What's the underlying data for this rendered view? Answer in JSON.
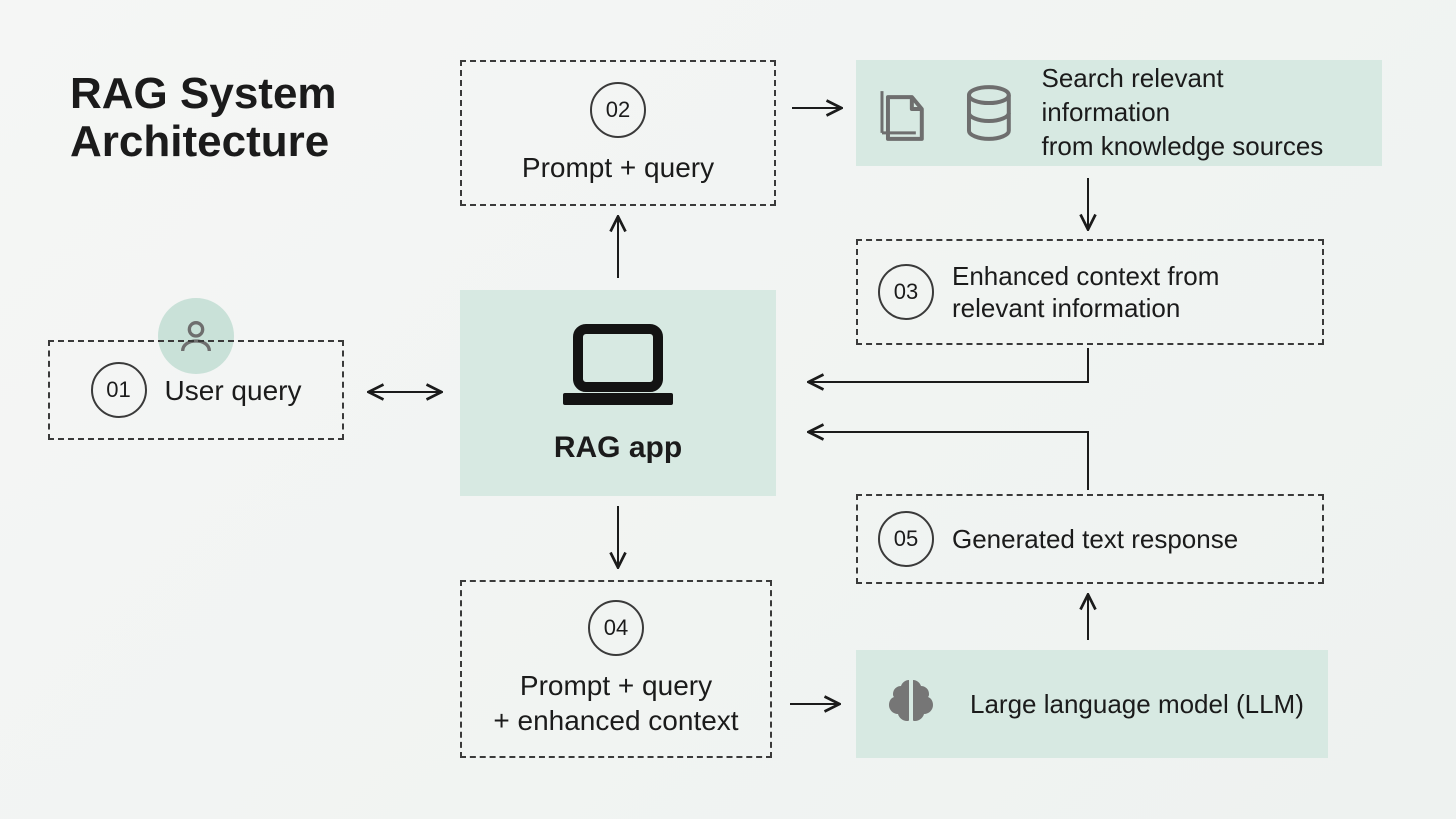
{
  "title": "RAG System\nArchitecture",
  "nodes": {
    "n01": {
      "num": "01",
      "label": "User query"
    },
    "n02": {
      "num": "02",
      "label": "Prompt + query"
    },
    "rag": {
      "label": "RAG app"
    },
    "n03": {
      "num": "03",
      "label": "Enhanced context from\nrelevant information"
    },
    "n04": {
      "num": "04",
      "label": "Prompt + query\n+ enhanced context"
    },
    "n05": {
      "num": "05",
      "label": "Generated text response"
    },
    "ksrc": {
      "label": "Search relevant information\nfrom knowledge sources"
    },
    "llm": {
      "label": "Large language model (LLM)"
    }
  }
}
